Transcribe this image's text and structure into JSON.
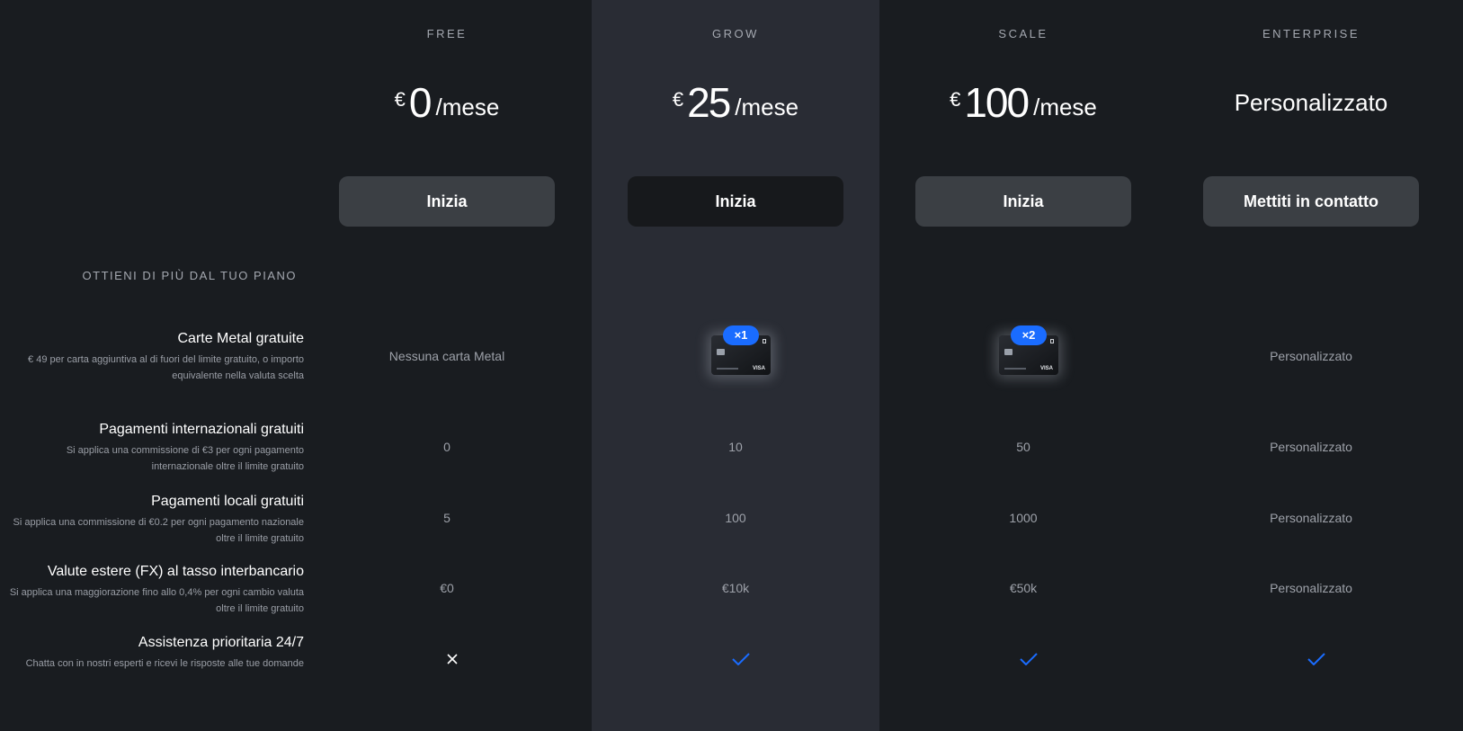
{
  "plans": [
    {
      "name": "FREE",
      "currency": "€",
      "amount": "0",
      "period": "/mese",
      "cta": "Inizia"
    },
    {
      "name": "GROW",
      "currency": "€",
      "amount": "25",
      "period": "/mese",
      "cta": "Inizia"
    },
    {
      "name": "SCALE",
      "currency": "€",
      "amount": "100",
      "period": "/mese",
      "cta": "Inizia"
    },
    {
      "name": "ENTERPRISE",
      "price_text": "Personalizzato",
      "cta": "Mettiti in contatto"
    }
  ],
  "section_title": "OTTIENI DI PIÙ DAL TUO PIANO",
  "features": [
    {
      "title": "Carte Metal gratuite",
      "desc": "€ 49 per carta aggiuntiva al di fuori del limite gratuito, o importo equivalente nella valuta scelta",
      "values": [
        "Nessuna carta Metal",
        "×1",
        "×2",
        "Personalizzato"
      ]
    },
    {
      "title": "Pagamenti internazionali gratuiti",
      "desc": "Si applica una commissione di €3 per ogni pagamento internazionale oltre il limite gratuito",
      "values": [
        "0",
        "10",
        "50",
        "Personalizzato"
      ]
    },
    {
      "title": "Pagamenti locali gratuiti",
      "desc": "Si applica una commissione di €0.2 per ogni pagamento nazionale oltre il limite gratuito",
      "values": [
        "5",
        "100",
        "1000",
        "Personalizzato"
      ]
    },
    {
      "title": "Valute estere (FX) al tasso interbancario",
      "desc": "Si applica una maggiorazione fino allo 0,4% per ogni cambio valuta oltre il limite gratuito",
      "values": [
        "€0",
        "€10k",
        "€50k",
        "Personalizzato"
      ]
    },
    {
      "title": "Assistenza prioritaria 24/7",
      "desc": "Chatta con in nostri esperti e ricevi le risposte alle tue domande",
      "values": [
        "x-icon",
        "check-icon",
        "check-icon",
        "check-icon"
      ]
    }
  ],
  "card_visa_label": "VISA",
  "colors": {
    "accent": "#1a6cff",
    "background": "#191c20",
    "highlight_column": "#292c34"
  }
}
